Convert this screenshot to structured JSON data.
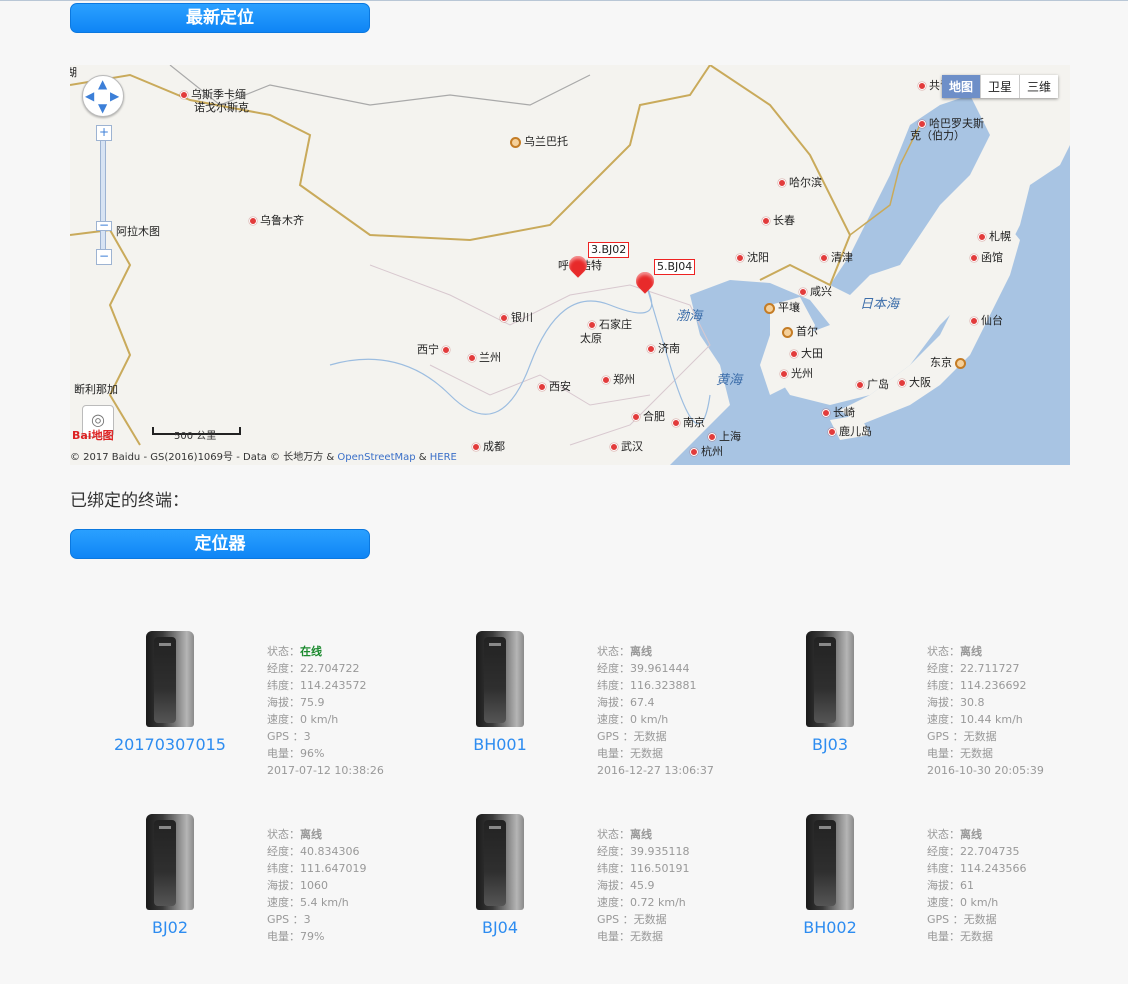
{
  "sections": {
    "latest_location": "最新定位",
    "bound_terminals": "已绑定的终端：",
    "locator": "定位器"
  },
  "map": {
    "types": [
      "地图",
      "卫星",
      "三维"
    ],
    "active_type": "地图",
    "copyright_prefix": "© 2017 Baidu - GS(2016)1069号 - Data © 长地万方 & ",
    "osm": "OpenStreetMap",
    "amp": " & ",
    "here": "HERE",
    "scale": "500 公里",
    "logo": "Bai地图",
    "markers": [
      "3.BJ02",
      "5.BJ04"
    ],
    "seas": [
      "渤海",
      "黄海",
      "日本海"
    ],
    "cities": [
      {
        "name": "乌斯季卡缅",
        "cap": false
      },
      {
        "name": "诺戈尔斯克",
        "cap": false
      },
      {
        "name": "乌兰巴托",
        "cap": true
      },
      {
        "name": "哈尔滨",
        "cap": false
      },
      {
        "name": "哈巴罗夫斯",
        "cap": false
      },
      {
        "name": "克（伯力）",
        "cap": false
      },
      {
        "name": "乌鲁木齐",
        "cap": false
      },
      {
        "name": "阿拉木图",
        "cap": false
      },
      {
        "name": "长春",
        "cap": false
      },
      {
        "name": "札幌",
        "cap": false
      },
      {
        "name": "呼和浩特",
        "cap": false
      },
      {
        "name": "沈阳",
        "cap": false
      },
      {
        "name": "清津",
        "cap": false
      },
      {
        "name": "函馆",
        "cap": false
      },
      {
        "name": "咸兴",
        "cap": false
      },
      {
        "name": "平壤",
        "cap": true
      },
      {
        "name": "银川",
        "cap": false
      },
      {
        "name": "石家庄",
        "cap": false
      },
      {
        "name": "首尔",
        "cap": true
      },
      {
        "name": "仙台",
        "cap": false
      },
      {
        "name": "太原",
        "cap": false
      },
      {
        "name": "西宁",
        "cap": false
      },
      {
        "name": "兰州",
        "cap": false
      },
      {
        "name": "济南",
        "cap": false
      },
      {
        "name": "大田",
        "cap": false
      },
      {
        "name": "东京",
        "cap": true
      },
      {
        "name": "西安",
        "cap": false
      },
      {
        "name": "郑州",
        "cap": false
      },
      {
        "name": "光州",
        "cap": false
      },
      {
        "name": "广岛",
        "cap": false
      },
      {
        "name": "大阪",
        "cap": false
      },
      {
        "name": "断利那加",
        "cap": false
      },
      {
        "name": "合肥",
        "cap": false
      },
      {
        "name": "南京",
        "cap": false
      },
      {
        "name": "长崎",
        "cap": false
      },
      {
        "name": "鹿儿岛",
        "cap": false
      },
      {
        "name": "上海",
        "cap": false
      },
      {
        "name": "成都",
        "cap": false
      },
      {
        "name": "武汉",
        "cap": false
      },
      {
        "name": "杭州",
        "cap": false
      },
      {
        "name": "共青",
        "cap": false
      }
    ]
  },
  "labels": {
    "status": "状态：",
    "lng": "经度：",
    "lat": "纬度：",
    "alt": "海拔：",
    "speed": "速度：",
    "gps": " GPS ：",
    "battery": "电量："
  },
  "devices": [
    {
      "name": "20170307015",
      "status": "在线",
      "online": true,
      "lng": "22.704722",
      "lat": "114.243572",
      "alt": "75.9",
      "speed": "0 km/h",
      "gps": "3",
      "battery": "96%",
      "time": "2017-07-12 10:38:26"
    },
    {
      "name": "BH001",
      "status": "离线",
      "online": false,
      "lng": "39.961444",
      "lat": "116.323881",
      "alt": "67.4",
      "speed": "0 km/h",
      "gps": "无数据",
      "battery": "无数据",
      "time": "2016-12-27 13:06:37"
    },
    {
      "name": "BJ03",
      "status": "离线",
      "online": false,
      "lng": "22.711727",
      "lat": "114.236692",
      "alt": "30.8",
      "speed": "10.44 km/h",
      "gps": "无数据",
      "battery": "无数据",
      "time": "2016-10-30 20:05:39"
    },
    {
      "name": "BJ02",
      "status": "离线",
      "online": false,
      "lng": "40.834306",
      "lat": "111.647019",
      "alt": "1060",
      "speed": "5.4 km/h",
      "gps": "3",
      "battery": "79%",
      "time": ""
    },
    {
      "name": "BJ04",
      "status": "离线",
      "online": false,
      "lng": "39.935118",
      "lat": "116.50191",
      "alt": "45.9",
      "speed": "0.72 km/h",
      "gps": "无数据",
      "battery": "无数据",
      "time": ""
    },
    {
      "name": "BH002",
      "status": "离线",
      "online": false,
      "lng": "22.704735",
      "lat": "114.243566",
      "alt": "61",
      "speed": "0 km/h",
      "gps": "无数据",
      "battery": "无数据",
      "time": ""
    }
  ]
}
